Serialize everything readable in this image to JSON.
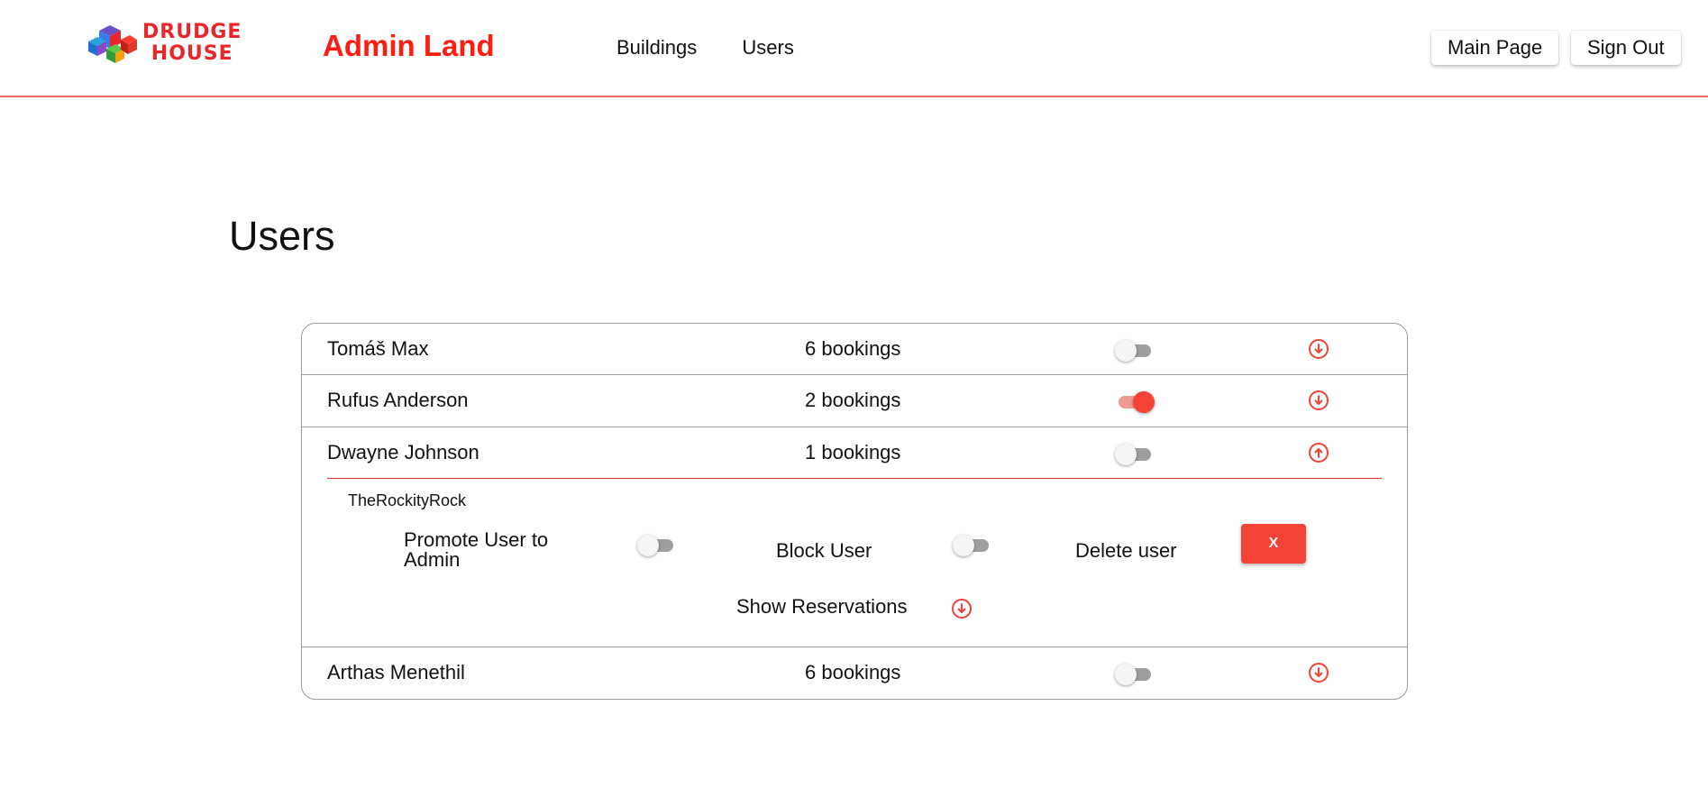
{
  "header": {
    "logo_line1": "DRUDGE",
    "logo_line2": "HOUSE",
    "brand": "Admin Land",
    "nav": [
      "Buildings",
      "Users"
    ],
    "main_page": "Main Page",
    "sign_out": "Sign Out"
  },
  "page_title": "Users",
  "colors": {
    "accent": "#f44336",
    "brand_red": "#ff1d12",
    "divider": "#9a9a9a"
  },
  "users": [
    {
      "name": "Tomáš Max",
      "bookings": "6 bookings",
      "toggle_on": false,
      "expanded": false,
      "arrow_icon": "arrow-down-circle-icon"
    },
    {
      "name": "Rufus Anderson",
      "bookings": "2 bookings",
      "toggle_on": true,
      "expanded": false,
      "arrow_icon": "arrow-down-circle-icon"
    },
    {
      "name": "Dwayne Johnson",
      "bookings": "1 bookings",
      "toggle_on": false,
      "expanded": true,
      "arrow_icon": "arrow-up-circle-icon"
    },
    {
      "name": "Arthas Menethil",
      "bookings": "6 bookings",
      "toggle_on": false,
      "expanded": false,
      "arrow_icon": "arrow-down-circle-icon"
    }
  ],
  "detail": {
    "username": "TheRockityRock",
    "promote_label_1": "Promote User to",
    "promote_label_2": "Admin",
    "promote_on": false,
    "block_label": "Block User",
    "block_on": false,
    "delete_label": "Delete user",
    "delete_button": "X",
    "show_reservations": "Show Reservations"
  }
}
